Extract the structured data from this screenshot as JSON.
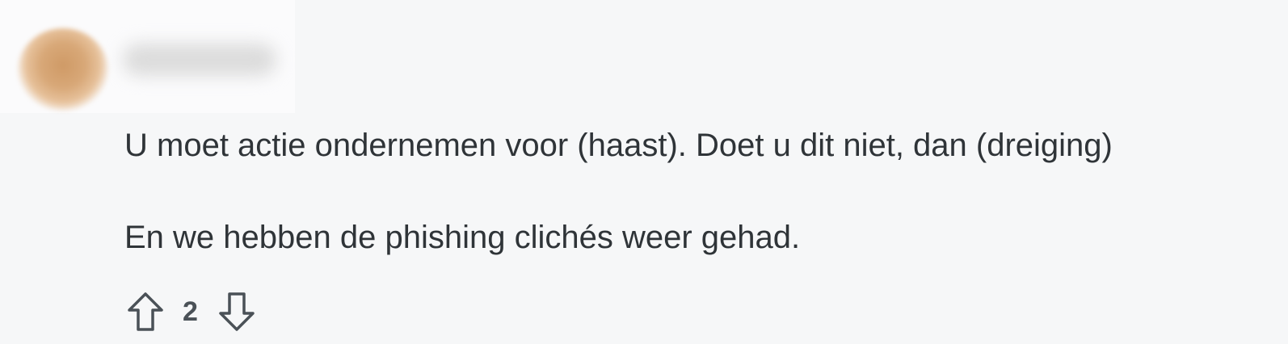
{
  "comment": {
    "author": {
      "avatar_icon": "user-avatar-blurred",
      "username_blurred": true
    },
    "body": {
      "paragraphs": [
        "U moet actie ondernemen voor (haast). Doet u dit niet, dan (dreiging)",
        "En we hebben de phishing clichés weer gehad."
      ]
    },
    "actions": {
      "upvote_icon": "arrow-up-outline-icon",
      "score": "2",
      "downvote_icon": "arrow-down-outline-icon"
    }
  },
  "colors": {
    "text": "#2f3438",
    "background": "#f6f7f8",
    "avatar": "#d8a878"
  }
}
